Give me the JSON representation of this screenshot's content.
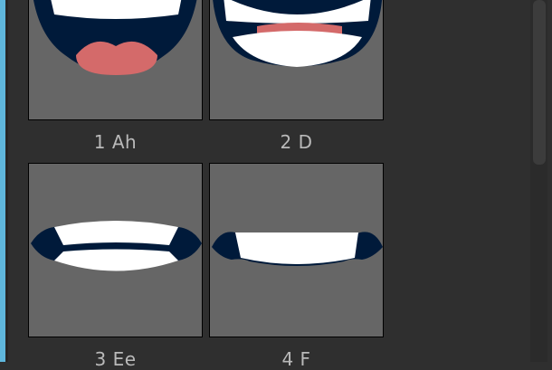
{
  "viewemes": [
    {
      "label": "1 Ah",
      "shape": "ah"
    },
    {
      "label": "2 D",
      "shape": "d"
    },
    {
      "label": "3 Ee",
      "shape": "ee"
    },
    {
      "label": "4 F",
      "shape": "f"
    }
  ],
  "colors": {
    "panel_bg": "#2f2f2f",
    "thumb_bg": "#666666",
    "mouth_dark": "#001a3a",
    "teeth": "#ffffff",
    "tongue": "#d46a6a",
    "label_text": "#b9b9b9",
    "left_accent": "#5fb7dd"
  },
  "scrollbar": {
    "orientation": "vertical"
  }
}
